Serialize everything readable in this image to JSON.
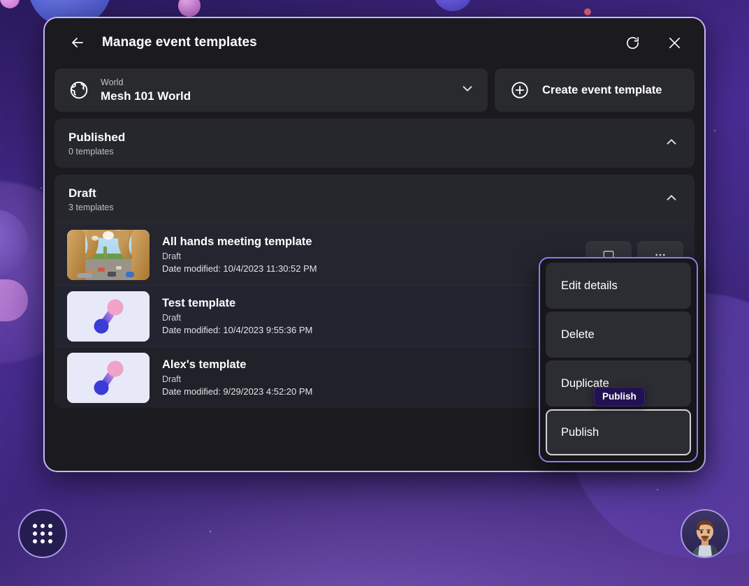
{
  "window": {
    "title": "Manage event templates",
    "back_icon": "back-arrow-icon",
    "refresh_icon": "refresh-icon",
    "close_icon": "close-icon"
  },
  "world_selector": {
    "icon": "globe-icon",
    "label": "World",
    "value": "Mesh 101 World",
    "chevron": "chevron-down-icon"
  },
  "create_button": {
    "icon": "plus-circle-icon",
    "label": "Create event template"
  },
  "sections": [
    {
      "title": "Published",
      "subtitle": "0 templates",
      "chevron": "chevron-up-icon",
      "templates": []
    },
    {
      "title": "Draft",
      "subtitle": "3 templates",
      "chevron": "chevron-up-icon",
      "templates": [
        {
          "name": "All hands meeting template",
          "status": "Draft",
          "date": "Date modified: 10/4/2023 11:30:52 PM",
          "thumbnail": "virtual-world-scene-thumbnail"
        },
        {
          "name": "Test template",
          "status": "Draft",
          "date": "Date modified: 10/4/2023 9:55:36 PM",
          "thumbnail": "mesh-logo-thumbnail"
        },
        {
          "name": "Alex's template",
          "status": "Draft",
          "date": "Date modified: 9/29/2023 4:52:20 PM",
          "thumbnail": "mesh-logo-thumbnail"
        }
      ]
    }
  ],
  "context_menu": {
    "items": [
      {
        "label": "Edit details",
        "focused": false
      },
      {
        "label": "Delete",
        "focused": false
      },
      {
        "label": "Duplicate",
        "focused": false
      },
      {
        "label": "Publish",
        "focused": true
      }
    ]
  },
  "tooltip": {
    "text": "Publish"
  },
  "taskbar": {
    "app_launcher_icon": "app-grid-icon",
    "avatar_icon": "user-avatar"
  },
  "colors": {
    "panel_border": "#c6b9f2",
    "menu_border": "#8b7ef0",
    "panel_bg": "#1b1b1f",
    "tooltip_bg": "#221252",
    "accent": "#8b7ef0"
  }
}
